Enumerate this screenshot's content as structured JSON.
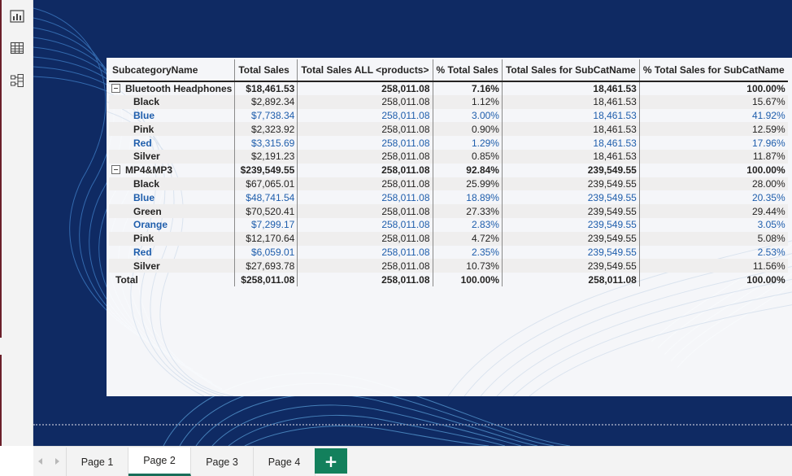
{
  "left_rail": {
    "icons": [
      "report-view-icon",
      "table-view-icon",
      "model-view-icon"
    ]
  },
  "matrix": {
    "headers": [
      "SubcategoryName",
      "Total Sales",
      "Total Sales ALL <products>",
      "% Total Sales",
      "Total Sales for SubCatName",
      "% Total Sales for SubCatName"
    ],
    "rows": [
      {
        "kind": "group",
        "name": "Bluetooth Headphones",
        "total_sales": "$18,461.53",
        "total_all": "258,011.08",
        "pct_total": "7.16%",
        "sub_total": "18,461.53",
        "pct_sub": "100.00%"
      },
      {
        "kind": "sub",
        "name": "Black",
        "total_sales": "$2,892.34",
        "total_all": "258,011.08",
        "pct_total": "1.12%",
        "sub_total": "18,461.53",
        "pct_sub": "15.67%"
      },
      {
        "kind": "sub",
        "name": "Blue",
        "total_sales": "$7,738.34",
        "total_all": "258,011.08",
        "pct_total": "3.00%",
        "sub_total": "18,461.53",
        "pct_sub": "41.92%"
      },
      {
        "kind": "sub",
        "name": "Pink",
        "total_sales": "$2,323.92",
        "total_all": "258,011.08",
        "pct_total": "0.90%",
        "sub_total": "18,461.53",
        "pct_sub": "12.59%"
      },
      {
        "kind": "sub",
        "name": "Red",
        "total_sales": "$3,315.69",
        "total_all": "258,011.08",
        "pct_total": "1.29%",
        "sub_total": "18,461.53",
        "pct_sub": "17.96%"
      },
      {
        "kind": "sub",
        "name": "Silver",
        "total_sales": "$2,191.23",
        "total_all": "258,011.08",
        "pct_total": "0.85%",
        "sub_total": "18,461.53",
        "pct_sub": "11.87%"
      },
      {
        "kind": "group",
        "name": "MP4&MP3",
        "total_sales": "$239,549.55",
        "total_all": "258,011.08",
        "pct_total": "92.84%",
        "sub_total": "239,549.55",
        "pct_sub": "100.00%"
      },
      {
        "kind": "sub",
        "name": "Black",
        "total_sales": "$67,065.01",
        "total_all": "258,011.08",
        "pct_total": "25.99%",
        "sub_total": "239,549.55",
        "pct_sub": "28.00%"
      },
      {
        "kind": "sub",
        "name": "Blue",
        "total_sales": "$48,741.54",
        "total_all": "258,011.08",
        "pct_total": "18.89%",
        "sub_total": "239,549.55",
        "pct_sub": "20.35%"
      },
      {
        "kind": "sub",
        "name": "Green",
        "total_sales": "$70,520.41",
        "total_all": "258,011.08",
        "pct_total": "27.33%",
        "sub_total": "239,549.55",
        "pct_sub": "29.44%"
      },
      {
        "kind": "sub",
        "name": "Orange",
        "total_sales": "$7,299.17",
        "total_all": "258,011.08",
        "pct_total": "2.83%",
        "sub_total": "239,549.55",
        "pct_sub": "3.05%"
      },
      {
        "kind": "sub",
        "name": "Pink",
        "total_sales": "$12,170.64",
        "total_all": "258,011.08",
        "pct_total": "4.72%",
        "sub_total": "239,549.55",
        "pct_sub": "5.08%"
      },
      {
        "kind": "sub",
        "name": "Red",
        "total_sales": "$6,059.01",
        "total_all": "258,011.08",
        "pct_total": "2.35%",
        "sub_total": "239,549.55",
        "pct_sub": "2.53%"
      },
      {
        "kind": "sub",
        "name": "Silver",
        "total_sales": "$27,693.78",
        "total_all": "258,011.08",
        "pct_total": "10.73%",
        "sub_total": "239,549.55",
        "pct_sub": "11.56%"
      },
      {
        "kind": "total",
        "name": "Total",
        "total_sales": "$258,011.08",
        "total_all": "258,011.08",
        "pct_total": "100.00%",
        "sub_total": "258,011.08",
        "pct_sub": "100.00%"
      }
    ]
  },
  "tabs": {
    "items": [
      "Page 1",
      "Page 2",
      "Page 3",
      "Page 4"
    ],
    "active": "Page 2",
    "add_label": "+"
  },
  "colors": {
    "canvas": "#0f2a63",
    "highlight_text": "#1f5eac",
    "add_tab": "#13805c",
    "active_tab_underline": "#1a6e5a"
  }
}
